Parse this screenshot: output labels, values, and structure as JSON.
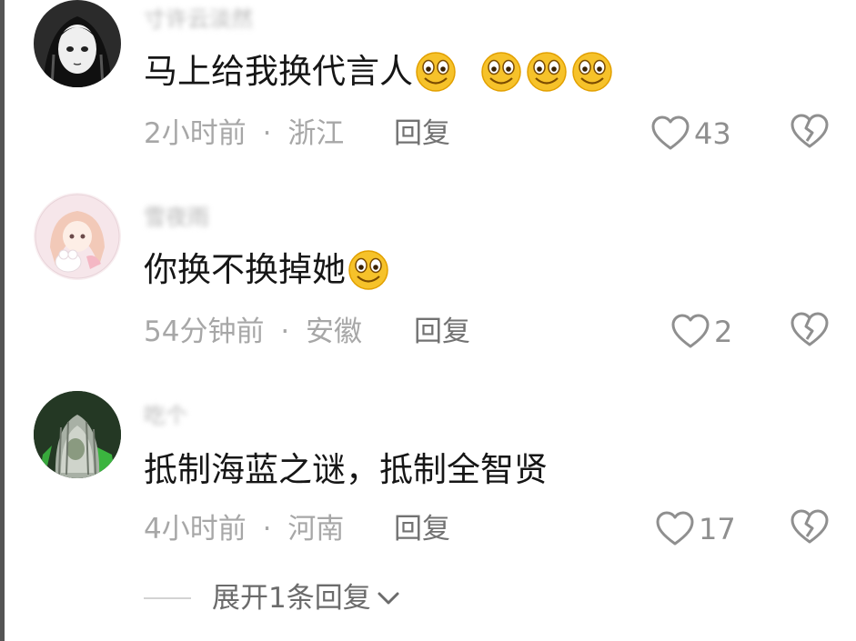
{
  "comments": [
    {
      "username": "寸许云淡然",
      "text": "马上给我换代言人",
      "emojis": [
        "smiley-emoji",
        "smiley-emoji",
        "smiley-emoji",
        "smiley-emoji"
      ],
      "time": "2小时前",
      "location": "浙江",
      "reply_label": "回复",
      "likes": "43"
    },
    {
      "username": "雪夜雨",
      "text": "你换不换掉她",
      "emojis": [
        "smiley-emoji"
      ],
      "time": "54分钟前",
      "location": "安徽",
      "reply_label": "回复",
      "likes": "2"
    },
    {
      "username": "吃个",
      "text": "抵制海蓝之谜，抵制全智贤",
      "emojis": [],
      "time": "4小时前",
      "location": "河南",
      "reply_label": "回复",
      "likes": "17"
    }
  ],
  "meta_separator": "·",
  "expand_replies": "展开1条回复",
  "icons": {
    "like": "heart-outline-icon",
    "dislike": "broken-heart-icon",
    "expand": "chevron-down-icon"
  }
}
